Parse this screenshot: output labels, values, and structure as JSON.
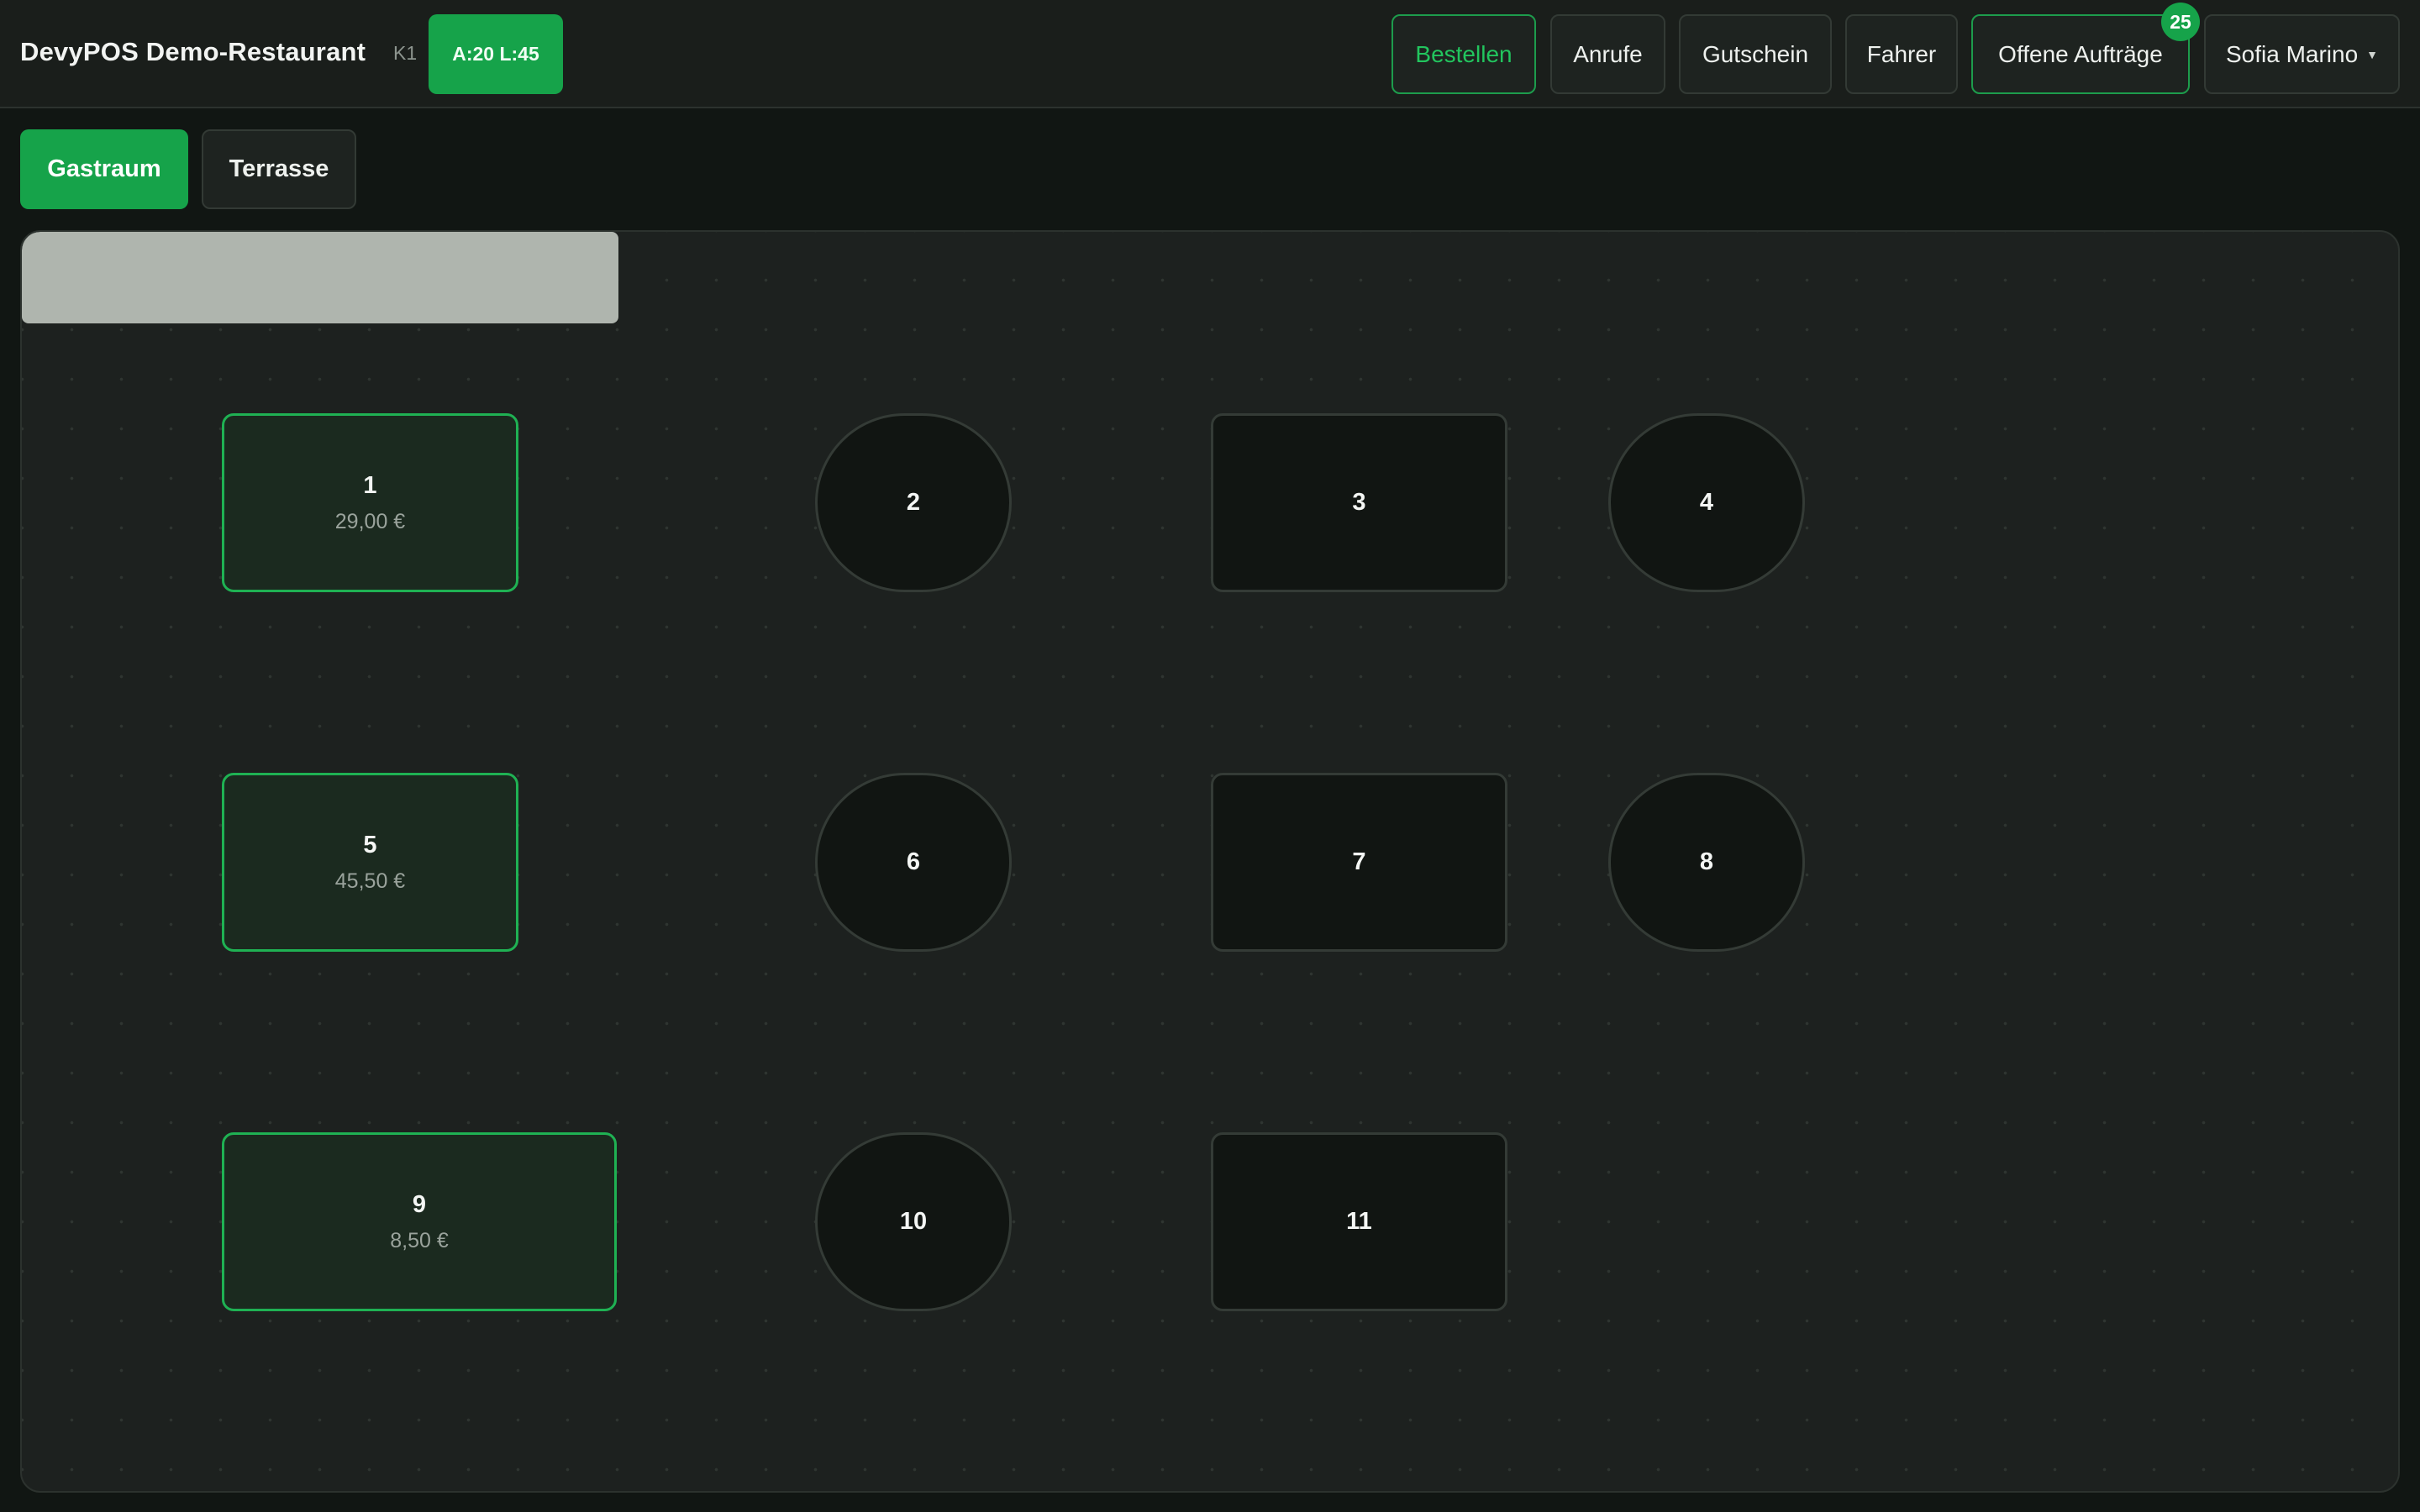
{
  "header": {
    "title": "DevyPOS Demo-Restaurant",
    "terminal": "K1",
    "counter": "A:20 L:45",
    "buttons": {
      "order": "Bestellen",
      "calls": "Anrufe",
      "voucher": "Gutschein",
      "drivers": "Fahrer",
      "open_orders": "Offene Aufträge",
      "open_orders_count": "25",
      "user": "Sofia Marino"
    }
  },
  "rooms": {
    "active": "Gastraum",
    "other": "Terrasse"
  },
  "tables": [
    {
      "number": "1",
      "amount": "29,00 €",
      "shape": "rect",
      "occupied": true
    },
    {
      "number": "2",
      "amount": "",
      "shape": "round",
      "occupied": false
    },
    {
      "number": "3",
      "amount": "",
      "shape": "rect",
      "occupied": false
    },
    {
      "number": "4",
      "amount": "",
      "shape": "round",
      "occupied": false
    },
    {
      "number": "5",
      "amount": "45,50 €",
      "shape": "rect",
      "occupied": true
    },
    {
      "number": "6",
      "amount": "",
      "shape": "round",
      "occupied": false
    },
    {
      "number": "7",
      "amount": "",
      "shape": "rect",
      "occupied": false
    },
    {
      "number": "8",
      "amount": "",
      "shape": "round",
      "occupied": false
    },
    {
      "number": "9",
      "amount": "8,50 €",
      "shape": "rect",
      "occupied": true
    },
    {
      "number": "10",
      "amount": "",
      "shape": "round",
      "occupied": false
    },
    {
      "number": "11",
      "amount": "",
      "shape": "rect",
      "occupied": false
    }
  ],
  "colors": {
    "accent": "#16a34a",
    "occupied_border": "#1fb153",
    "background": "#111613"
  },
  "icons": {
    "user_menu": "chevron-down-icon"
  }
}
